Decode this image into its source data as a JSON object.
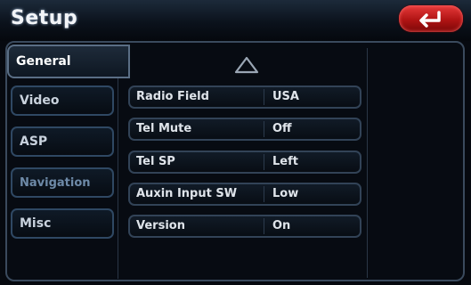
{
  "header": {
    "title": "Setup",
    "back_icon": "return-arrow-icon",
    "back_color": "#c41a1a"
  },
  "tabs": [
    {
      "label": "General",
      "active": true
    },
    {
      "label": "Video",
      "active": false
    },
    {
      "label": "ASP",
      "active": false
    },
    {
      "label": "Navigation",
      "active": false
    },
    {
      "label": "Misc",
      "active": false
    }
  ],
  "scroll_up_icon": "triangle-up-icon",
  "settings": [
    {
      "label": "Radio Field",
      "value": "USA"
    },
    {
      "label": "Tel Mute",
      "value": "Off"
    },
    {
      "label": "Tel SP",
      "value": "Left"
    },
    {
      "label": "Auxin Input SW",
      "value": "Low"
    },
    {
      "label": "Version",
      "value": "On"
    }
  ]
}
